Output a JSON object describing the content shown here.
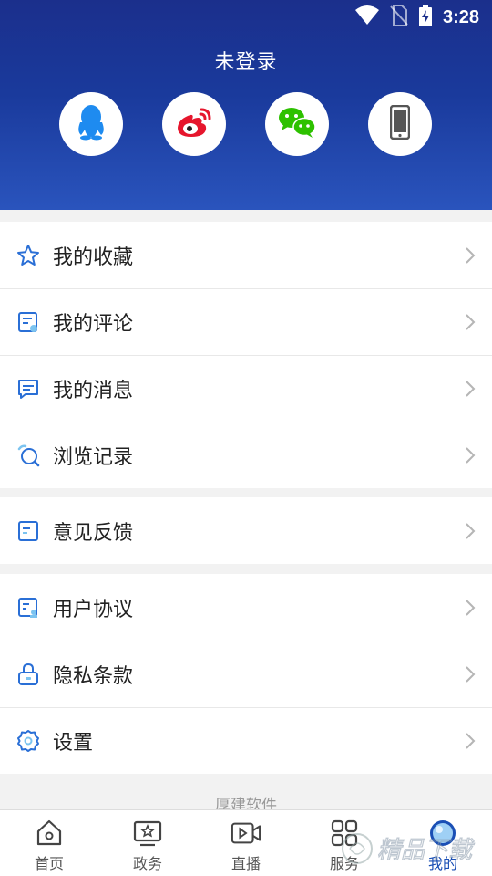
{
  "status": {
    "time": "3:28",
    "icons": [
      "wifi-icon",
      "no-sim-icon",
      "battery-charging-icon"
    ]
  },
  "header": {
    "title": "未登录",
    "login_options": [
      {
        "name": "qq-login",
        "icon": "qq-icon",
        "color": "#1e8bf0"
      },
      {
        "name": "weibo-login",
        "icon": "weibo-icon",
        "color": "#e6162d"
      },
      {
        "name": "wechat-login",
        "icon": "wechat-icon",
        "color": "#2dc100"
      },
      {
        "name": "phone-login",
        "icon": "phone-icon",
        "color": "#555555"
      }
    ]
  },
  "menu": {
    "section1": [
      {
        "label": "我的收藏",
        "icon": "star-icon"
      },
      {
        "label": "我的评论",
        "icon": "comment-doc-icon"
      },
      {
        "label": "我的消息",
        "icon": "message-icon"
      },
      {
        "label": "浏览记录",
        "icon": "history-icon"
      }
    ],
    "section2": [
      {
        "label": "意见反馈",
        "icon": "feedback-icon"
      }
    ],
    "section3": [
      {
        "label": "用户协议",
        "icon": "agreement-icon"
      },
      {
        "label": "隐私条款",
        "icon": "lock-icon"
      },
      {
        "label": "设置",
        "icon": "gear-icon"
      }
    ]
  },
  "footer": {
    "text": "厚建软件"
  },
  "tabbar": {
    "items": [
      {
        "label": "首页",
        "icon": "home-icon"
      },
      {
        "label": "政务",
        "icon": "government-icon"
      },
      {
        "label": "直播",
        "icon": "live-video-icon"
      },
      {
        "label": "服务",
        "icon": "services-grid-icon"
      },
      {
        "label": "我的",
        "icon": "profile-icon",
        "active": true
      }
    ]
  },
  "colors": {
    "accent": "#1a4fb5",
    "header_top": "#1b2f8c",
    "header_bottom": "#2a54bd",
    "icon_blue": "#2a6fd6"
  },
  "watermark": {
    "text": "精品下载"
  }
}
